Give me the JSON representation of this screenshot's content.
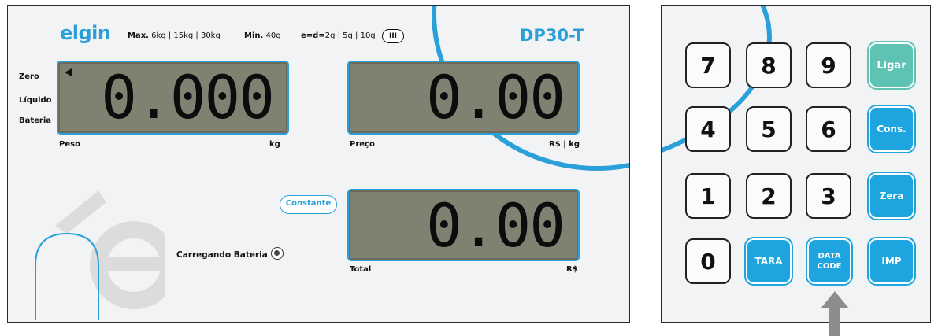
{
  "display": {
    "brand": "elgin",
    "specs": {
      "max_label": "Max.",
      "max_value": "6kg | 15kg | 30kg",
      "min_label": "Min.",
      "min_value": "40g",
      "e_label": "e=d=",
      "e_value": "2g | 5g | 10g",
      "class": "III"
    },
    "model": "DP30-T",
    "indicators": [
      "Zero",
      "Líquido",
      "Bateria"
    ],
    "weight": {
      "value": "0.000",
      "label": "Peso",
      "unit": "kg"
    },
    "price": {
      "value": "0.00",
      "label": "Preço",
      "unit": "R$ | kg"
    },
    "total": {
      "value": "0.00",
      "label": "Total",
      "unit": "R$"
    },
    "constante_label": "Constante",
    "charging_label": "Carregando Bateria"
  },
  "keypad": {
    "keys": [
      {
        "label": "7"
      },
      {
        "label": "8"
      },
      {
        "label": "9"
      },
      {
        "label": "Ligar"
      },
      {
        "label": "4"
      },
      {
        "label": "5"
      },
      {
        "label": "6"
      },
      {
        "label": "Cons."
      },
      {
        "label": "1"
      },
      {
        "label": "2"
      },
      {
        "label": "3"
      },
      {
        "label": "Zera"
      },
      {
        "label": "0"
      },
      {
        "label": "TARA"
      },
      {
        "label": "DATA CODE"
      },
      {
        "label": "IMP"
      }
    ]
  },
  "colors": {
    "accent": "#2a9fd8",
    "function_key": "#1ea5df",
    "power_key": "#5fc3b4",
    "lcd": "#818171",
    "pointer_arrow": "#8c8c8c"
  }
}
